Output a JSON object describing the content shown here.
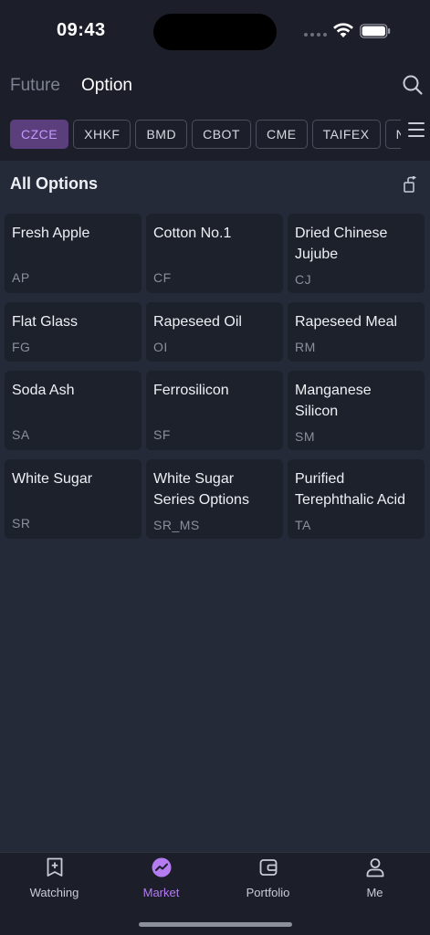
{
  "status": {
    "time": "09:43"
  },
  "header": {
    "tabs": [
      {
        "label": "Future",
        "active": false
      },
      {
        "label": "Option",
        "active": true
      }
    ]
  },
  "exchanges": [
    "CZCE",
    "XHKF",
    "BMD",
    "CBOT",
    "CME",
    "TAIFEX",
    "NYMEX"
  ],
  "selected_exchange": "CZCE",
  "section": {
    "title": "All Options"
  },
  "products": [
    {
      "name": "Fresh Apple",
      "code": "AP"
    },
    {
      "name": "Cotton No.1",
      "code": "CF"
    },
    {
      "name": "Dried Chinese Jujube",
      "code": "CJ"
    },
    {
      "name": "Flat Glass",
      "code": "FG"
    },
    {
      "name": "Rapeseed Oil",
      "code": "OI"
    },
    {
      "name": "Rapeseed Meal",
      "code": "RM"
    },
    {
      "name": "Soda Ash",
      "code": "SA"
    },
    {
      "name": "Ferrosilicon",
      "code": "SF"
    },
    {
      "name": "Manganese Silicon",
      "code": "SM"
    },
    {
      "name": "White Sugar",
      "code": "SR"
    },
    {
      "name": "White Sugar Series Options",
      "code": "SR_MS"
    },
    {
      "name": "Purified Terephthalic Acid",
      "code": "TA"
    }
  ],
  "nav": [
    {
      "label": "Watching",
      "icon": "bookmark-plus-icon"
    },
    {
      "label": "Market",
      "icon": "market-trend-icon",
      "active": true
    },
    {
      "label": "Portfolio",
      "icon": "wallet-icon"
    },
    {
      "label": "Me",
      "icon": "user-icon"
    }
  ],
  "colors": {
    "accent": "#b57cf2",
    "chip_active_bg": "#5a3f7c",
    "background": "#252a38",
    "card": "#1d212c"
  }
}
